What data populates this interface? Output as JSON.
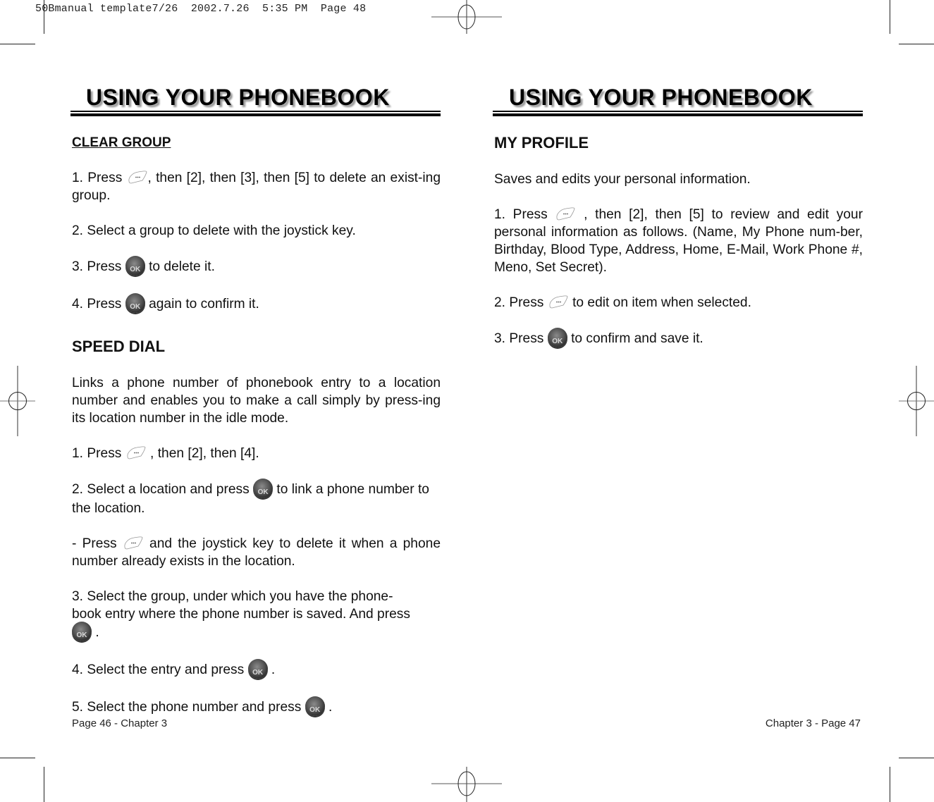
{
  "slug": "50Bmanual template7/26  2002.7.26  5:35 PM  Page 48",
  "left_page": {
    "header": "USING YOUR PHONEBOOK",
    "clear_group": {
      "title": "CLEAR GROUP",
      "step1_a": "1. Press ",
      "step1_b": ", then [2], then [3], then [5] to delete an exist-ing group.",
      "step2": "2.  Select a group to delete with the joystick key.",
      "step3_a": "3.  Press ",
      "step3_b": " to delete it.",
      "step4_a": "4.  Press ",
      "step4_b": " again to confirm it."
    },
    "speed_dial": {
      "title": "SPEED DIAL",
      "intro": "Links a phone number of phonebook entry to a location number and enables you to make a call simply by press-ing its location number in the idle mode.",
      "step1_a": "1. Press ",
      "step1_b": " , then [2], then [4].",
      "step2_a": "2.  Select a location and press ",
      "step2_b": " to link a phone number to the location.",
      "note_a": "- Press ",
      "note_b": " and the joystick key to delete it when a phone number already exists in the location.",
      "step3_a": "3.  Select the group, under which you have the phone-book entry where the phone number is saved. And press ",
      "step3_b": " .",
      "step4_a": "4.  Select the entry and press ",
      "step4_b": " .",
      "step5_a": "5.  Select the phone number and press ",
      "step5_b": " ."
    },
    "footer": "Page 46 - Chapter 3"
  },
  "right_page": {
    "header": "USING YOUR PHONEBOOK",
    "my_profile": {
      "title": "MY PROFILE",
      "intro": "Saves and edits your personal information.",
      "step1_a": "1. Press ",
      "step1_b": " , then [2], then [5] to review and edit your personal information as follows. (Name, My Phone num-ber, Birthday, Blood Type, Address, Home, E-Mail, Work Phone #, Meno, Set Secret).",
      "step2_a": "2.  Press ",
      "step2_b": " to edit on item when selected.",
      "step3_a": "3.  Press ",
      "step3_b": " to confirm and save it."
    },
    "footer": "Chapter 3 - Page 47"
  },
  "icons": {
    "menu_key": "menu-soft-key-icon",
    "ok_key": "ok-button-icon"
  }
}
